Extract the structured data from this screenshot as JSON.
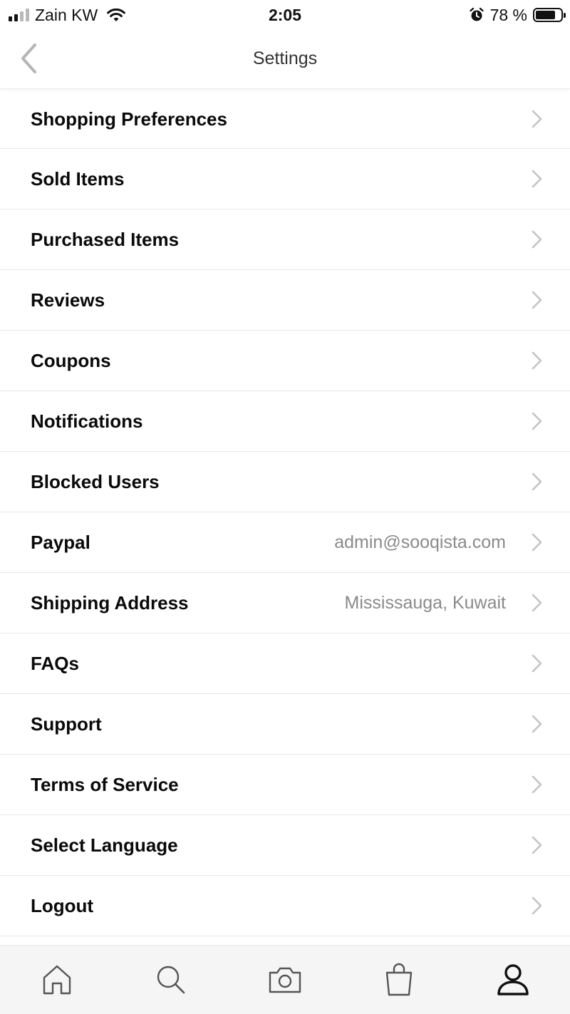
{
  "status_bar": {
    "carrier": "Zain KW",
    "time": "2:05",
    "battery_percent": "78 %",
    "battery_level": 0.78
  },
  "nav": {
    "title": "Settings"
  },
  "settings": [
    {
      "label": "Shopping Preferences",
      "value": ""
    },
    {
      "label": "Sold Items",
      "value": ""
    },
    {
      "label": "Purchased Items",
      "value": ""
    },
    {
      "label": "Reviews",
      "value": ""
    },
    {
      "label": "Coupons",
      "value": ""
    },
    {
      "label": "Notifications",
      "value": ""
    },
    {
      "label": "Blocked Users",
      "value": ""
    },
    {
      "label": "Paypal",
      "value": "admin@sooqista.com"
    },
    {
      "label": "Shipping Address",
      "value": "Mississauga, Kuwait"
    },
    {
      "label": "FAQs",
      "value": ""
    },
    {
      "label": "Support",
      "value": ""
    },
    {
      "label": "Terms of Service",
      "value": ""
    },
    {
      "label": "Select Language",
      "value": ""
    },
    {
      "label": "Logout",
      "value": ""
    }
  ],
  "tab_bar": {
    "items": [
      {
        "icon": "home-icon"
      },
      {
        "icon": "search-icon"
      },
      {
        "icon": "camera-icon"
      },
      {
        "icon": "shopping-bag-icon"
      },
      {
        "icon": "profile-icon",
        "active": true
      }
    ]
  },
  "colors": {
    "value_text": "#8a8a8a",
    "chevron": "#c4c4c4",
    "tab_inactive": "#555555",
    "tab_active": "#111111",
    "tab_bar_bg": "#f5f5f5"
  }
}
